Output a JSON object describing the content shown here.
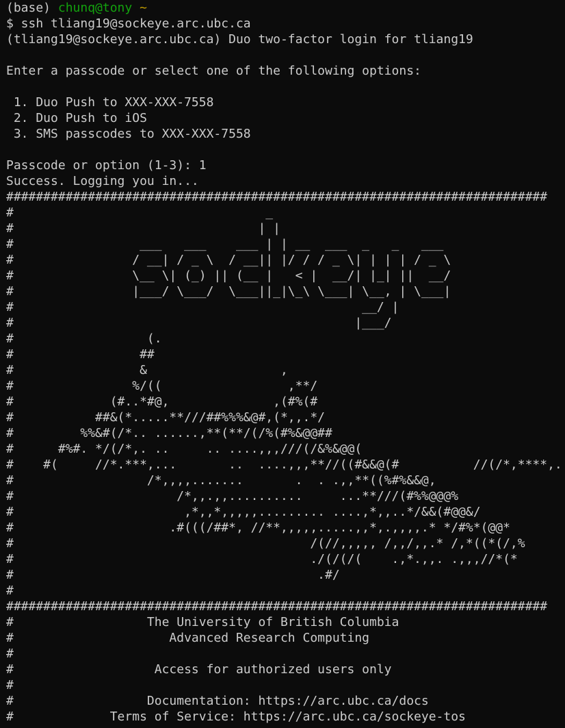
{
  "terminal": {
    "prompt": {
      "env": "(base) ",
      "user_host": "chunq@tony",
      "path": " ~"
    },
    "lines": [
      "$ ssh tliang19@sockeye.arc.ubc.ca",
      "(tliang19@sockeye.arc.ubc.ca) Duo two-factor login for tliang19",
      "",
      "Enter a passcode or select one of the following options:",
      "",
      " 1. Duo Push to XXX-XXX-7558",
      " 2. Duo Push to iOS",
      " 3. SMS passcodes to XXX-XXX-7558",
      "",
      "Passcode or option (1-3): 1",
      "Success. Logging you in...",
      "#########################################################################",
      "#                                  _",
      "#                                 | |",
      "#                 ___   ___    ___ | | __  ___  _   _   ___",
      "#                / __| / _ \\  / __|| |/ / / _ \\| | | | / _ \\",
      "#                \\__ \\| (_) || (__ |   < |  __/| |_| ||  __/",
      "#                |___/ \\___/  \\___||_|\\_\\ \\___| \\__, | \\___|",
      "#                                               __/ |",
      "#                                              |___/",
      "#                  (.",
      "#                 ##",
      "#                 &                  ,",
      "#                %/((                 ,**/",
      "#             (#..*#@,              ,(#%(#",
      "#           ##&(*.....**///##%%%&@#,(*,,.*/",
      "#         %%&#(/*.. ......,**(**/(/%(#%&@@##",
      "#      #%#. */(/*,. ..     .. ....,,,///(/&%&@@(",
      "#    #(     //*.***,...       ..  ....,,,**//((#&&@(#          //(/*,****,.",
      "#                  /*,,,,.......       .  . .,,**((%#%&&@,",
      "#                      /*,,.,,..........     ...**///(#%%@@@%",
      "#                       ,*,,*,,,,,......... ....,*,,..*/&&(#@@&/",
      "#                     .#(((/##*, //**,,,,,.....,,*,.,,,,.* */#%*(@@*",
      "#                                        /(//,,,,, /,,/,,.* /,*((*(/,%",
      "#                                        ./(/(/(    .,*.,,. .,,,//*(*",
      "#                                         .#/",
      "#",
      "#########################################################################",
      "#                  The University of British Columbia",
      "#                     Advanced Research Computing",
      "#",
      "#                   Access for authorized users only",
      "#",
      "#                  Documentation: https://arc.ubc.ca/docs",
      "#             Terms of Service: https://arc.ubc.ca/sockeye-tos"
    ]
  },
  "colors": {
    "background": "#0c0c0c",
    "foreground": "#cccccc",
    "user_host": "#13a10e",
    "path": "#c19c00"
  }
}
